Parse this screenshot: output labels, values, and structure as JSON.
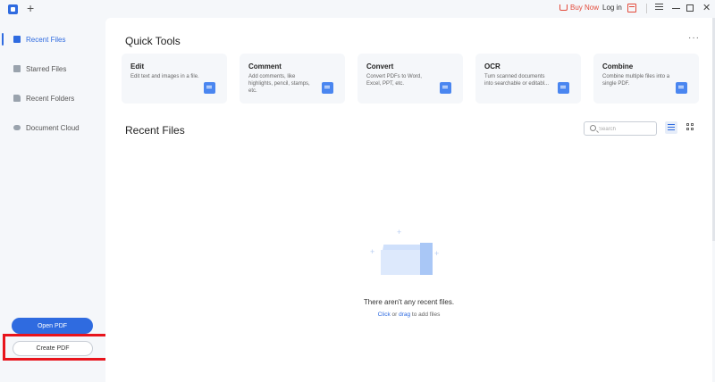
{
  "titlebar": {
    "new_tab": "+",
    "buy_now": "Buy Now",
    "login": "Log in"
  },
  "sidebar": {
    "items": [
      {
        "label": "Recent Files",
        "icon": "document-icon",
        "active": true
      },
      {
        "label": "Starred Files",
        "icon": "star-icon",
        "active": false
      },
      {
        "label": "Recent Folders",
        "icon": "folder-icon",
        "active": false
      },
      {
        "label": "Document Cloud",
        "icon": "cloud-icon",
        "active": false
      }
    ],
    "open_pdf": "Open PDF",
    "create_pdf": "Create PDF"
  },
  "quick_tools": {
    "title": "Quick Tools",
    "more": "···",
    "cards": [
      {
        "title": "Edit",
        "desc": "Edit text and images in a file."
      },
      {
        "title": "Comment",
        "desc": "Add comments, like highlights, pencil, stamps, etc."
      },
      {
        "title": "Convert",
        "desc": "Convert PDFs to Word, Excel, PPT, etc."
      },
      {
        "title": "OCR",
        "desc": "Turn scanned documents into searchable or editabl..."
      },
      {
        "title": "Combine",
        "desc": "Combine multiple files into a single PDF."
      }
    ]
  },
  "recent_files": {
    "title": "Recent Files",
    "search_placeholder": "Search",
    "empty_text": "There aren't any recent files.",
    "hint_click": "Click",
    "hint_or": " or ",
    "hint_drag": "drag",
    "hint_rest": " to add files"
  },
  "colors": {
    "accent": "#2f6be0",
    "highlight": "#e8141c",
    "buy_now": "#e34a3a"
  }
}
